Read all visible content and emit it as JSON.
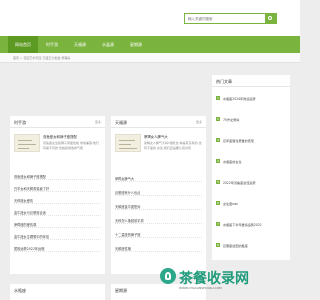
{
  "search": {
    "placeholder": "输入关键词搜索"
  },
  "nav": {
    "items": [
      {
        "label": "网站首页"
      },
      {
        "label": "时手游"
      },
      {
        "label": "天福源"
      },
      {
        "label": "水晶源"
      },
      {
        "label": "星期源"
      }
    ]
  },
  "breadcrumb": "首页 > 花园艺术乐园 万盛正大批发 整理房",
  "panels": {
    "left": {
      "title": "时手游",
      "more": "更多",
      "feature": {
        "title": "双鱼座女和狮子座搭配",
        "desc": "双鱼座女生和狮子男座性格 非常兼容,他们有着不同的 性格和成熟的气质"
      },
      "items": [
        "双鱼座女和狮子座搭配",
        "白羊女和天蝎男谁赢了好",
        "天秤座女爱情",
        "金牛座女与巨蟹谁合适",
        "摩羯座的爱情观",
        "金牛座女生理想中的伴侣",
        "属相运势2022年运程"
      ]
    },
    "center": {
      "title": "天福源",
      "more": "更多",
      "feature": {
        "title": "摩羯女人脾气大",
        "desc": "摩羯女人脾气大吗?相处这 种是有没有的,也有不差的 女生,我们还是要认真对待"
      },
      "items": [
        "摩羯女脾气大",
        "巨蟹座有什么优点",
        "天蝎座金牛座配对",
        "天秤怎么挽回射手男",
        "十二星座的狮子座",
        "天蝎座性格"
      ]
    },
    "right": {
      "title": "热门文章",
      "items": [
        "水瓶座2024年财运运势",
        "70岁女男嫁",
        "巨年座属性男爱的表现",
        "水瓶座的女生",
        "2022年双鱼座最佳运势",
        "女生套nan",
        "水瓶座下半年爱情运势2021",
        "巨蟹座最配的星座"
      ]
    },
    "bottom_left": {
      "title": "水瓶座"
    },
    "bottom_center": {
      "title": "星期源"
    }
  },
  "watermark": {
    "text": "茶餐收录网",
    "sub": "WWW.CHACANSHOULU.COM"
  },
  "colors": {
    "accent": "#7ab33e",
    "accent_dark": "#5d9a24",
    "watermark": "#1f9b7c"
  }
}
